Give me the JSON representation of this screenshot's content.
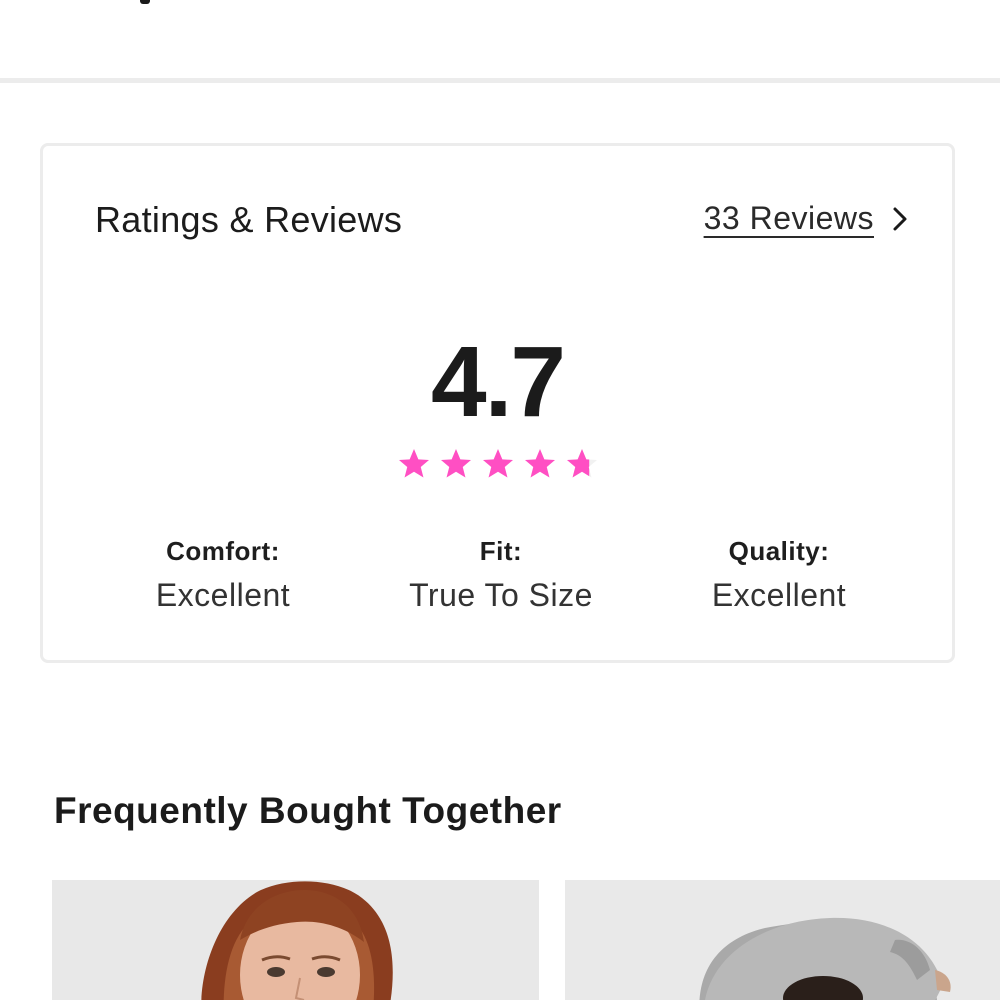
{
  "ratings": {
    "title": "Ratings & Reviews",
    "reviews_link": "33 Reviews",
    "score": "4.7",
    "stars_value": 4.7,
    "stars_max": 5,
    "star_color": "#ff4fc3",
    "attributes": [
      {
        "label": "Comfort:",
        "value": "Excellent"
      },
      {
        "label": "Fit:",
        "value": "True To Size"
      },
      {
        "label": "Quality:",
        "value": "Excellent"
      }
    ]
  },
  "frequently_bought": {
    "title": "Frequently Bought Together",
    "products": [
      {
        "image": "model-portrait-photo"
      },
      {
        "image": "grey-sweater-photo"
      }
    ]
  }
}
